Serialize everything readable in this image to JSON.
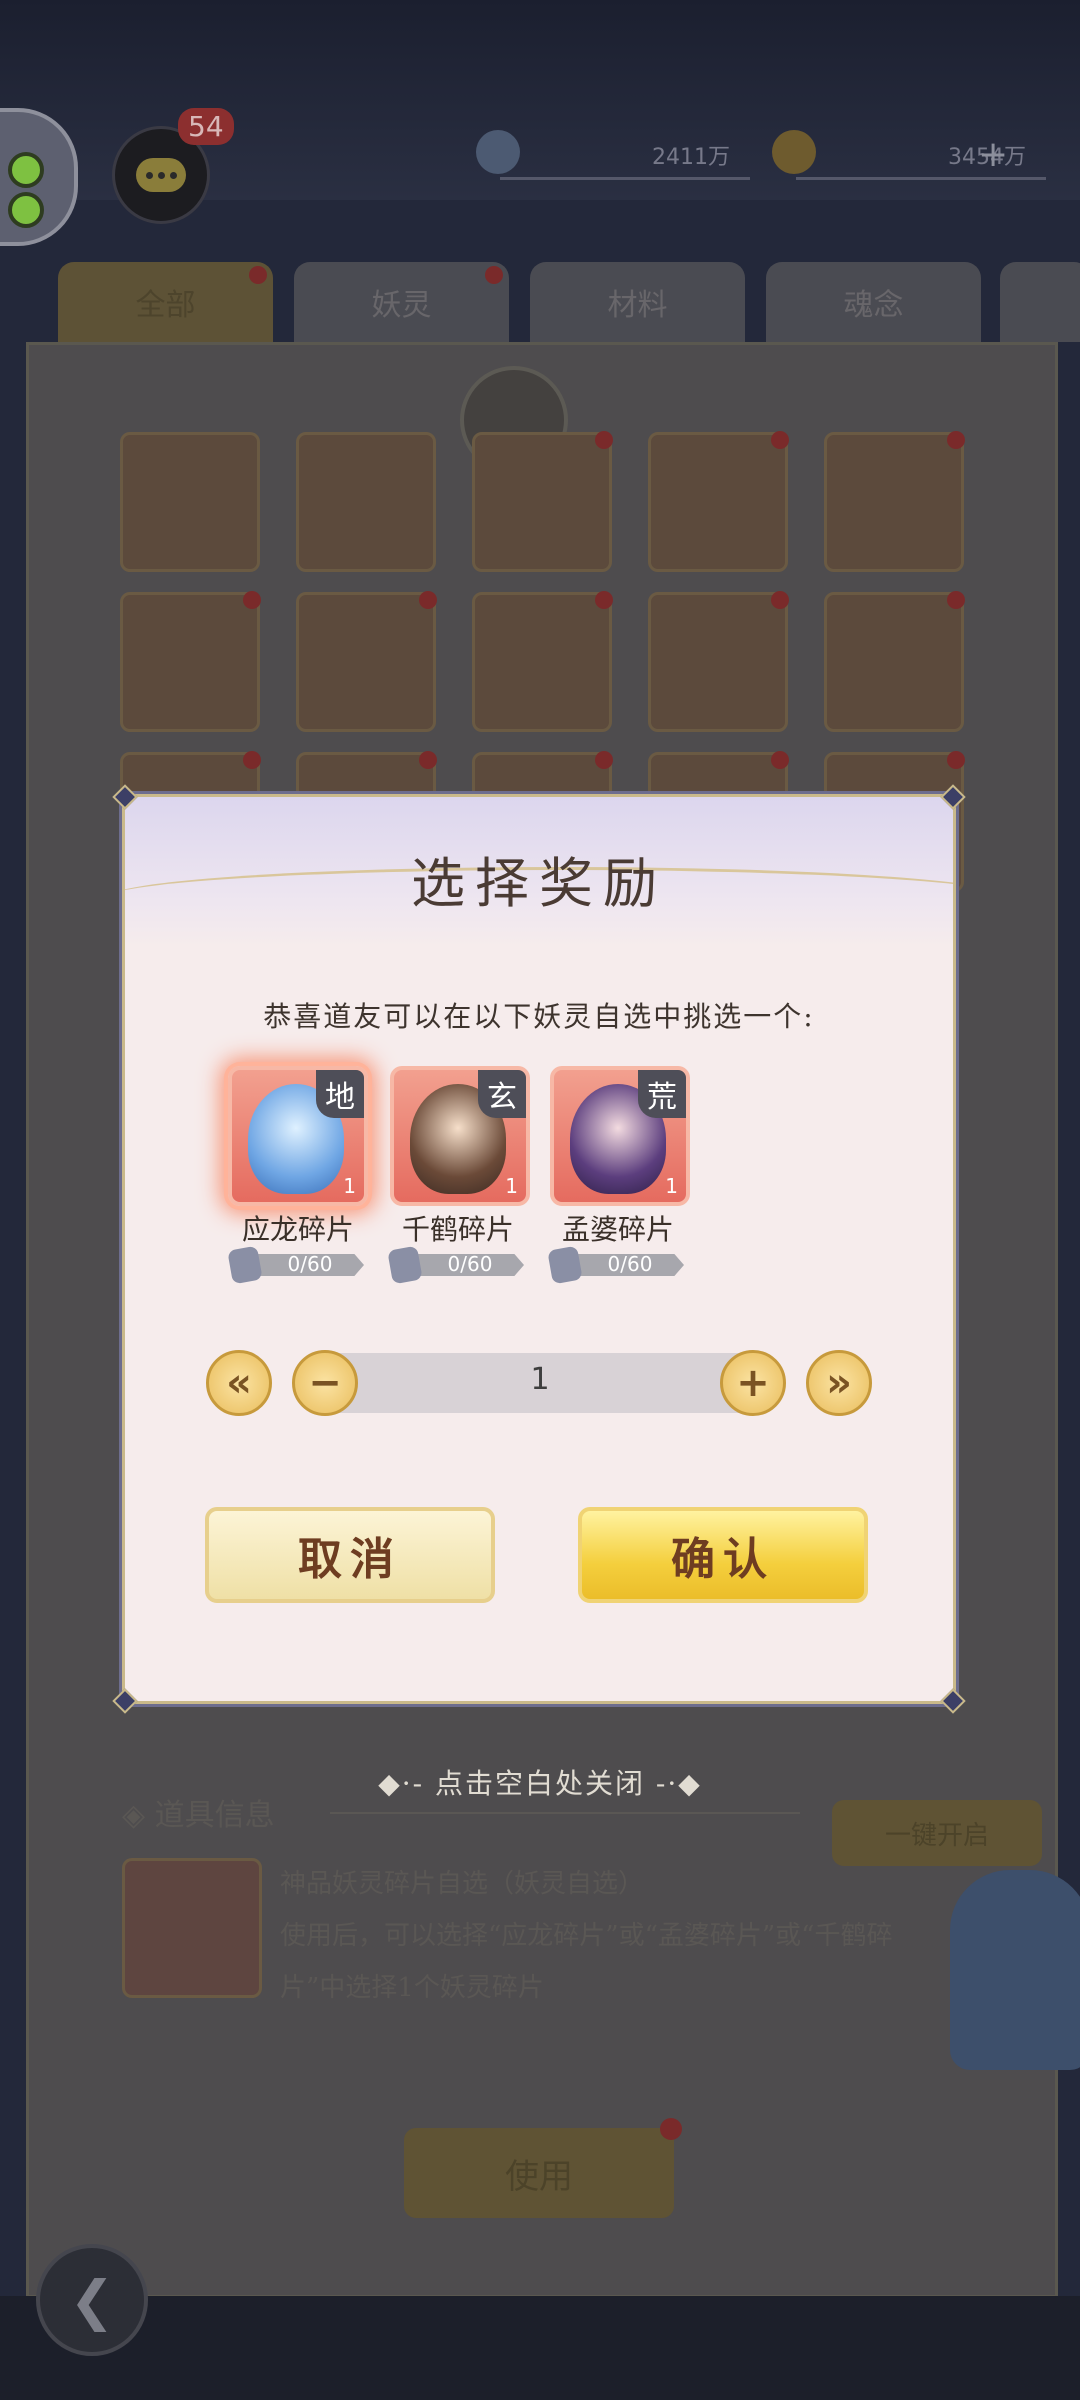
{
  "topbar": {
    "chat_badge_count": "54",
    "currency_1": "2411万",
    "currency_2": "3454万",
    "plus_label": "+"
  },
  "tabs": [
    {
      "label": "全部"
    },
    {
      "label": "妖灵"
    },
    {
      "label": "材料"
    },
    {
      "label": "魂念"
    }
  ],
  "background": {
    "section_title": "◈ 道具信息",
    "one_key_label": "一键开启",
    "item_name": "神品妖灵碎片自选（妖灵自选）",
    "item_desc": "使用后，可以选择“应龙碎片”或“孟婆碎片”或“千鹤碎片”中选择1个妖灵碎片",
    "use_label": "使用"
  },
  "modal": {
    "title": "选择奖励",
    "subtitle": "恭喜道友可以在以下妖灵自选中挑选一个:",
    "options": [
      {
        "name": "应龙碎片",
        "grade": "地",
        "count": "1",
        "progress": "0/60",
        "progress_value": 0,
        "selected": true
      },
      {
        "name": "千鹤碎片",
        "grade": "玄",
        "count": "1",
        "progress": "0/60",
        "progress_value": 0,
        "selected": false
      },
      {
        "name": "孟婆碎片",
        "grade": "荒",
        "count": "1",
        "progress": "0/60",
        "progress_value": 0,
        "selected": false
      }
    ],
    "quantity": "1",
    "min_label": "«",
    "minus_label": "−",
    "plus_label": "+",
    "max_label": "»",
    "cancel_label": "取消",
    "confirm_label": "确认"
  },
  "close_hint": "◆·- 点击空白处关闭 -·◆",
  "colors": {
    "modal_bg": "#f6ecec",
    "confirm_gold": "#f4cf3d",
    "card_red": "#e56b5f",
    "grade_badge": "#4e4e58"
  }
}
